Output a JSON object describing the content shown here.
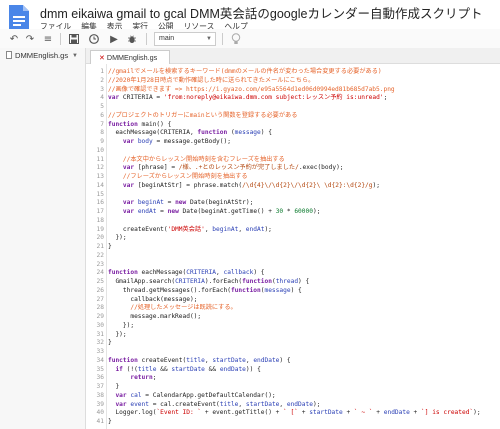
{
  "window": {
    "title": "dmm eikaiwa gmail to gcal  DMM英会話のgoogleカレンダー自動作成スクリプト"
  },
  "menu": [
    "ファイル",
    "編集",
    "表示",
    "実行",
    "公開",
    "リソース",
    "ヘルプ"
  ],
  "toolbar": {
    "function_select": "main"
  },
  "files": {
    "items": [
      {
        "label": "DMMEnglish.gs"
      }
    ]
  },
  "editor": {
    "active_tab": "DMMEnglish.gs",
    "lines": [
      [
        [
          "cm",
          "//gmailでメールを検索するキーワード(dmmのメールの件名が変わった場合変更する必要がある)"
        ]
      ],
      [
        [
          "cm",
          "//2020年1月28日時点で動作確認した時に送られてきたメールにこちら。"
        ]
      ],
      [
        [
          "cm",
          "//画像で確認できます => https://i.gyazo.com/e95a5564d1ed06d0994ed81b685d7ab5.png"
        ]
      ],
      [
        [
          "kw",
          "var "
        ],
        [
          "",
          "CRITERIA = "
        ],
        [
          "str",
          "'from:noreply@eikaiwa.dmm.com subject:レッスン予約 is:unread'"
        ],
        [
          "",
          ";"
        ]
      ],
      [],
      [
        [
          "cm",
          "//プロジェクトのトリガーにmainという関数を登録する必要がある"
        ]
      ],
      [
        [
          "kw",
          "function "
        ],
        [
          "",
          "main() {"
        ]
      ],
      [
        [
          "",
          "  eachMessage(CRITERIA, "
        ],
        [
          "kw",
          "function "
        ],
        [
          "",
          "("
        ],
        [
          "vr",
          "message"
        ],
        [
          "",
          ") {"
        ]
      ],
      [
        [
          "",
          "    "
        ],
        [
          "kw",
          "var "
        ],
        [
          "vr",
          "body"
        ],
        [
          "",
          " = message.getBody();"
        ]
      ],
      [],
      [
        [
          "",
          "    "
        ],
        [
          "cm",
          "//本文中からレッスン開始時刻を含むフレーズを抽出する"
        ]
      ],
      [
        [
          "",
          "    "
        ],
        [
          "kw",
          "var "
        ],
        [
          "",
          "[phrase] = "
        ],
        [
          "rx",
          "/様、.+とのレッスン予約が完了しました/"
        ],
        [
          "",
          ".exec(body);"
        ]
      ],
      [
        [
          "",
          "    "
        ],
        [
          "cm",
          "//フレーズからレッスン開始時刻を抽出する"
        ]
      ],
      [
        [
          "",
          "    "
        ],
        [
          "kw",
          "var "
        ],
        [
          "",
          "[beginAtStr] = phrase.match("
        ],
        [
          "rx",
          "/\\d{4}\\/\\d{2}\\/\\d{2}\\ \\d{2}:\\d{2}/g"
        ],
        [
          "",
          ");"
        ]
      ],
      [],
      [
        [
          "",
          "    "
        ],
        [
          "kw",
          "var "
        ],
        [
          "vr",
          "beginAt"
        ],
        [
          "",
          " = "
        ],
        [
          "kw",
          "new "
        ],
        [
          "",
          "Date(beginAtStr);"
        ]
      ],
      [
        [
          "",
          "    "
        ],
        [
          "kw",
          "var "
        ],
        [
          "vr",
          "endAt"
        ],
        [
          "",
          " = "
        ],
        [
          "kw",
          "new "
        ],
        [
          "",
          "Date(beginAt.getTime() + "
        ],
        [
          "num",
          "30"
        ],
        [
          "",
          " * "
        ],
        [
          "num",
          "60000"
        ],
        [
          "",
          ");"
        ]
      ],
      [],
      [
        [
          "",
          "    createEvent("
        ],
        [
          "str",
          "'DMM英会話'"
        ],
        [
          "",
          ", "
        ],
        [
          "vr",
          "beginAt"
        ],
        [
          "",
          ", "
        ],
        [
          "vr",
          "endAt"
        ],
        [
          "",
          ");"
        ]
      ],
      [
        [
          "",
          "  });"
        ]
      ],
      [
        [
          "",
          "}"
        ]
      ],
      [],
      [],
      [
        [
          "kw",
          "function "
        ],
        [
          "",
          "eachMessage("
        ],
        [
          "vr",
          "CRITERIA"
        ],
        [
          "",
          ", "
        ],
        [
          "vr",
          "callback"
        ],
        [
          "",
          ") {"
        ]
      ],
      [
        [
          "",
          "  GmailApp.search("
        ],
        [
          "vr",
          "CRITERIA"
        ],
        [
          "",
          ").forEach("
        ],
        [
          "kw",
          "function"
        ],
        [
          "",
          "("
        ],
        [
          "vr",
          "thread"
        ],
        [
          "",
          ") {"
        ]
      ],
      [
        [
          "",
          "    thread.getMessages().forEach("
        ],
        [
          "kw",
          "function"
        ],
        [
          "",
          "("
        ],
        [
          "vr",
          "message"
        ],
        [
          "",
          ") {"
        ]
      ],
      [
        [
          "",
          "      callback(message);"
        ]
      ],
      [
        [
          "",
          "      "
        ],
        [
          "cm",
          "//処理したメッセージは既読にする。"
        ]
      ],
      [
        [
          "",
          "      message.markRead();"
        ]
      ],
      [
        [
          "",
          "    });"
        ]
      ],
      [
        [
          "",
          "  });"
        ]
      ],
      [
        [
          "",
          "}"
        ]
      ],
      [],
      [
        [
          "kw",
          "function "
        ],
        [
          "",
          "createEvent("
        ],
        [
          "vr",
          "title"
        ],
        [
          "",
          ", "
        ],
        [
          "vr",
          "startDate"
        ],
        [
          "",
          ", "
        ],
        [
          "vr",
          "endDate"
        ],
        [
          "",
          ") {"
        ]
      ],
      [
        [
          "",
          "  "
        ],
        [
          "kw",
          "if "
        ],
        [
          "",
          "(!("
        ],
        [
          "vr",
          "title"
        ],
        [
          "",
          " && "
        ],
        [
          "vr",
          "startDate"
        ],
        [
          "",
          " && "
        ],
        [
          "vr",
          "endDate"
        ],
        [
          "",
          ")) {"
        ]
      ],
      [
        [
          "",
          "      "
        ],
        [
          "kw",
          "return"
        ],
        [
          "",
          ";"
        ]
      ],
      [
        [
          "",
          "  }"
        ]
      ],
      [
        [
          "",
          "  "
        ],
        [
          "kw",
          "var "
        ],
        [
          "vr",
          "cal"
        ],
        [
          "",
          " = CalendarApp.getDefaultCalendar();"
        ]
      ],
      [
        [
          "",
          "  "
        ],
        [
          "kw",
          "var "
        ],
        [
          "vr",
          "event"
        ],
        [
          "",
          " = cal.createEvent("
        ],
        [
          "vr",
          "title"
        ],
        [
          "",
          ", "
        ],
        [
          "vr",
          "startDate"
        ],
        [
          "",
          ", "
        ],
        [
          "vr",
          "endDate"
        ],
        [
          "",
          ");"
        ]
      ],
      [
        [
          "",
          "  Logger.log("
        ],
        [
          "str",
          "`Event ID: `"
        ],
        [
          "",
          " + event.getTitle() + "
        ],
        [
          "str",
          "` [`"
        ],
        [
          "",
          " + "
        ],
        [
          "vr",
          "startDate"
        ],
        [
          "",
          " + "
        ],
        [
          "str",
          "` ~ `"
        ],
        [
          "",
          " + "
        ],
        [
          "vr",
          "endDate"
        ],
        [
          "",
          " + "
        ],
        [
          "str",
          "`] is created`"
        ],
        [
          "",
          ");"
        ]
      ],
      [
        [
          "",
          "}"
        ]
      ]
    ]
  },
  "colors": {
    "comment": "#e6642b",
    "keyword": "#7a1fa2",
    "string": "#cc0000",
    "variable": "#2a3fb5",
    "number": "#0a7a2d"
  }
}
